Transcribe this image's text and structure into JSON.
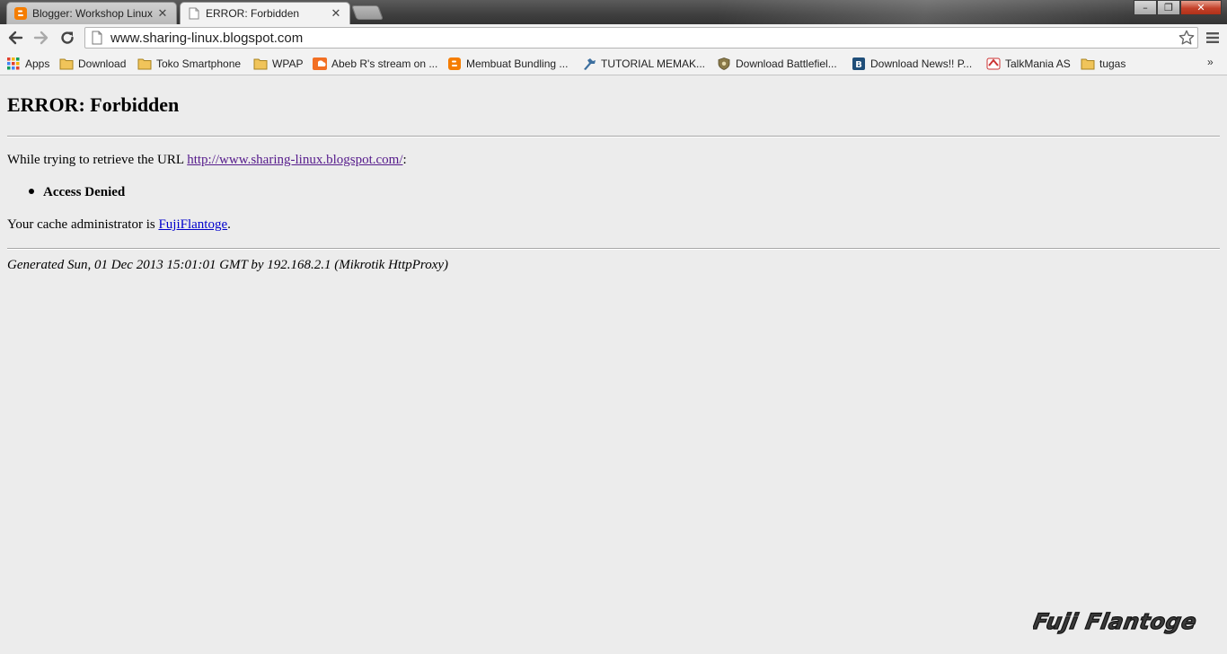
{
  "tabs": [
    {
      "title": "Blogger: Workshop Linux",
      "close": "✕",
      "active": false,
      "favicon": "blogger-icon"
    },
    {
      "title": "ERROR: Forbidden",
      "close": "✕",
      "active": true,
      "favicon": "page-icon"
    }
  ],
  "window_controls": {
    "minimize": "–",
    "maximize": "❐",
    "close": "✕"
  },
  "toolbar": {
    "back": "back-arrow-icon",
    "forward": "forward-arrow-icon",
    "reload": "reload-icon",
    "address": "www.sharing-linux.blogspot.com",
    "star": "star-icon",
    "menu": "menu-icon"
  },
  "bookmarks": [
    {
      "label": "Apps",
      "icon": "apps-grid-icon"
    },
    {
      "label": "Download",
      "icon": "folder-icon"
    },
    {
      "label": "Toko Smartphone",
      "icon": "folder-icon"
    },
    {
      "label": "WPAP",
      "icon": "folder-icon"
    },
    {
      "label": "Abeb R's stream on ...",
      "icon": "soundcloud-icon"
    },
    {
      "label": "Membuat Bundling ...",
      "icon": "blogger-icon"
    },
    {
      "label": "TUTORIAL MEMAK...",
      "icon": "wrench-icon"
    },
    {
      "label": "Download Battlefiel...",
      "icon": "shield-icon"
    },
    {
      "label": "Download News!! P...",
      "icon": "b-logo-icon"
    },
    {
      "label": "TalkMania AS",
      "icon": "talkmania-icon"
    },
    {
      "label": "tugas",
      "icon": "folder-icon"
    }
  ],
  "bookmarks_overflow": "»",
  "content": {
    "heading": "ERROR: Forbidden",
    "retrieve_prefix": "While trying to retrieve the URL ",
    "retrieve_url": "http://www.sharing-linux.blogspot.com/",
    "retrieve_suffix": ":",
    "error_item": "Access Denied",
    "admin_prefix": "Your cache administrator is ",
    "admin_name": "FujiFlantoge",
    "admin_suffix": ".",
    "generated": "Generated Sun, 01 Dec 2013 15:01:01 GMT by 192.168.2.1 (Mikrotik HttpProxy)"
  },
  "watermark": "Fuji Flantoge",
  "colors": {
    "link": "#0000cc",
    "visited_link": "#551a8b",
    "page_bg": "#ececec"
  }
}
